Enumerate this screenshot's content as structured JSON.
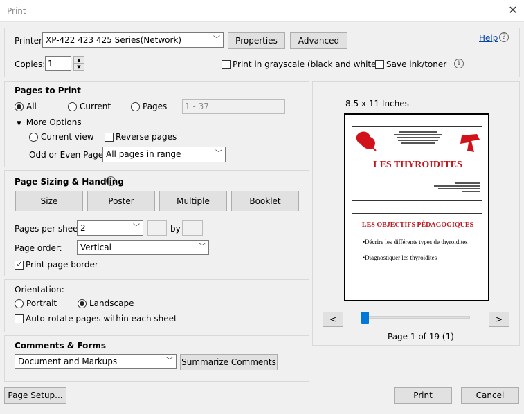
{
  "window": {
    "title": "Print",
    "close_symbol": "✕"
  },
  "printer": {
    "label": "Printer:",
    "selected": "XP-422 423 425 Series(Network)",
    "properties_label": "Properties",
    "advanced_label": "Advanced",
    "help_label": "Help"
  },
  "copies": {
    "label": "Copies:",
    "value": "1",
    "grayscale_label": "Print in grayscale (black and white)",
    "grayscale_checked": false,
    "save_ink_label": "Save ink/toner",
    "save_ink_checked": false
  },
  "pages_to_print": {
    "heading": "Pages to Print",
    "all_label": "All",
    "current_label": "Current",
    "pages_label": "Pages",
    "pages_placeholder": "1 - 37",
    "selected": "All",
    "more_options_label": "More Options",
    "current_view_label": "Current view",
    "reverse_pages_label": "Reverse pages",
    "odd_even_label": "Odd or Even Pages:",
    "odd_even_selected": "All pages in range"
  },
  "page_sizing": {
    "heading": "Page Sizing & Handling",
    "size_label": "Size",
    "poster_label": "Poster",
    "multiple_label": "Multiple",
    "booklet_label": "Booklet",
    "pages_per_sheet_label": "Pages per sheet:",
    "pages_per_sheet_value": "2",
    "by_label": "by",
    "page_order_label": "Page order:",
    "page_order_value": "Vertical",
    "print_border_label": "Print page border",
    "print_border_checked": true
  },
  "orientation": {
    "heading": "Orientation:",
    "portrait_label": "Portrait",
    "landscape_label": "Landscape",
    "selected": "Landscape",
    "auto_rotate_label": "Auto-rotate pages within each sheet",
    "auto_rotate_checked": false
  },
  "comments": {
    "heading": "Comments & Forms",
    "selected": "Document and Markups",
    "summarize_label": "Summarize Comments"
  },
  "preview": {
    "paper_size": "8.5 x 11 Inches",
    "slide1_title": "LES THYROIDITES",
    "slide2_title": "LES OBJECTIFS PÉDAGOGIQUES",
    "slide2_bullet1": "•Décrire les différents types de thyroidites",
    "slide2_bullet2": "•Diagnostiquer les thyroidites",
    "prev_symbol": "<",
    "next_symbol": ">",
    "page_status": "Page 1 of 19 (1)",
    "slider_fraction": 0
  },
  "footer": {
    "page_setup_label": "Page Setup...",
    "print_label": "Print",
    "cancel_label": "Cancel"
  },
  "icons": {
    "dropdown_arrow": "chevron-down-icon",
    "info": "info-icon",
    "help": "help-icon"
  }
}
